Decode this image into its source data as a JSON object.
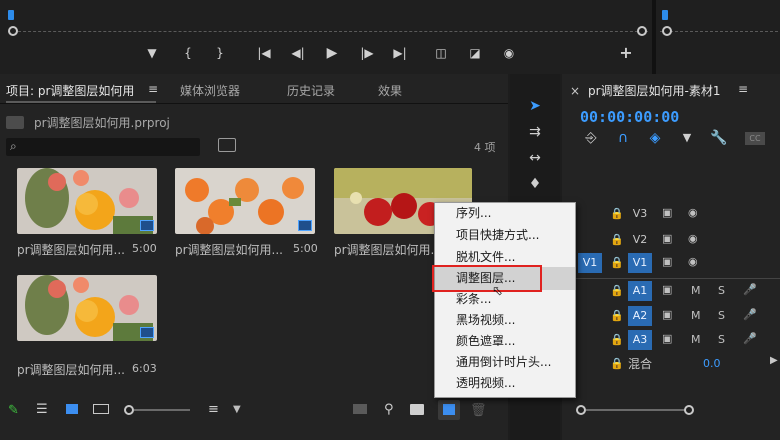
{
  "project_panel": {
    "tabs": [
      {
        "label": "项目: pr调整图层如何用",
        "active": true
      },
      {
        "label": "媒体浏览器"
      },
      {
        "label": "历史记录"
      },
      {
        "label": "效果"
      }
    ],
    "menu_glyph": "≡",
    "file_path": "pr调整图层如何用.prproj",
    "item_count": "4 项",
    "clips": [
      {
        "name": "pr调整图层如何用...",
        "duration": "5:00"
      },
      {
        "name": "pr调整图层如何用...",
        "duration": "5:00"
      },
      {
        "name": "pr调整图层如何用...",
        "duration": ""
      },
      {
        "name": "pr调整图层如何用...",
        "duration": "6:03"
      }
    ]
  },
  "timeline": {
    "sequence_title": "pr调整图层如何用-素材1",
    "menu_glyph": "≡",
    "close_glyph": "×",
    "timecode": "00:00:00:00",
    "video_tracks": [
      "V3",
      "V2",
      "V1"
    ],
    "source_track": "V1",
    "audio_tracks": [
      "A1",
      "A2",
      "A3"
    ],
    "mute_label": "M",
    "solo_label": "S",
    "mix_label": "混合",
    "mix_value": "0.0"
  },
  "context_menu": {
    "items": [
      "序列...",
      "项目快捷方式...",
      "脱机文件...",
      "调整图层...",
      "彩条...",
      "黑场视频...",
      "颜色遮罩...",
      "通用倒计时片头...",
      "透明视频..."
    ],
    "highlighted_index": 3
  },
  "colors": {
    "accent_blue": "#2d8ceb",
    "track_blue": "#2a6bb3",
    "highlight_red": "#e0221f",
    "menu_bg": "#f2f2f2"
  }
}
